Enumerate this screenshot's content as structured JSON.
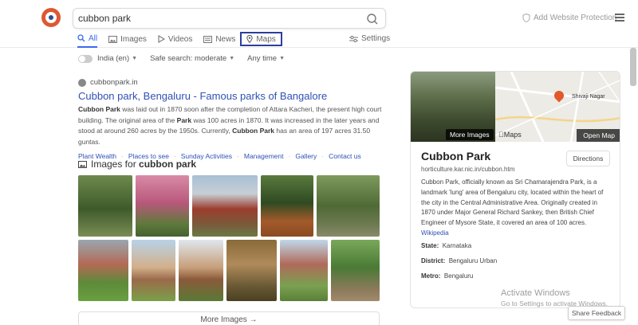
{
  "search": {
    "query": "cubbon park",
    "protect_label": "Add Website Protection"
  },
  "tabs": [
    {
      "label": "All",
      "icon": "search-icon",
      "active": true
    },
    {
      "label": "Images",
      "icon": "image-icon"
    },
    {
      "label": "Videos",
      "icon": "play-icon"
    },
    {
      "label": "News",
      "icon": "news-icon"
    },
    {
      "label": "Maps",
      "icon": "map-pin-icon"
    }
  ],
  "settings_label": "Settings",
  "filters": {
    "region": "India (en)",
    "safe_search": "Safe search: moderate",
    "time": "Any time"
  },
  "result": {
    "url": "cubbonpark.in",
    "title": "Cubbon park, Bengaluru - Famous parks of Bangalore",
    "snippet": {
      "p1": "Cubbon Park",
      "p2": " was laid out in 1870 soon after the completion of Attara Kacheri, the present high court building. The original area of the ",
      "p3": "Park",
      "p4": " was 100 acres in 1870. It was increased in the later years and stood at around 260 acres by the 1950s. Currently, ",
      "p5": "Cubbon Park",
      "p6": " has an area of 197 acres 31.50 guntas."
    },
    "sitelinks": [
      "Plant Wealth",
      "Places to see",
      "Sunday Activities",
      "Management",
      "Gallery",
      "Contact us"
    ]
  },
  "images": {
    "label_prefix": "Images for ",
    "label_query": "cubbon park",
    "more_label": "More Images →"
  },
  "knowledge_panel": {
    "title": "Cubbon Park",
    "site": "horticulture.kar.nic.in/cubbon.htm",
    "directions": "Directions",
    "more_images": "More Images",
    "open_map": "Open Map",
    "map_brand": "Maps",
    "map_place": "Shivaji Nagar",
    "description": "Cubbon Park, officially known as Sri Chamarajendra Park, is a landmark 'lung' area of Bengaluru city, located within the heart of the city in the Central Administrative Area. Originally created in 1870 under Major General Richard Sankey, then British Chief Engineer of Mysore State, it covered an area of 100 acres.",
    "wiki": "Wikipedia",
    "state_label": "State:",
    "state": "Karnataka",
    "district_label": "District:",
    "district": "Bengaluru Urban",
    "metro_label": "Metro:",
    "metro": "Bengaluru"
  },
  "watermark": {
    "line1": "Activate Windows",
    "line2": "Go to Settings to activate Windows."
  },
  "feedback": "Share Feedback",
  "colors": {
    "accent": "#3969ef",
    "link": "#2f51b5",
    "brand": "#de5833"
  }
}
